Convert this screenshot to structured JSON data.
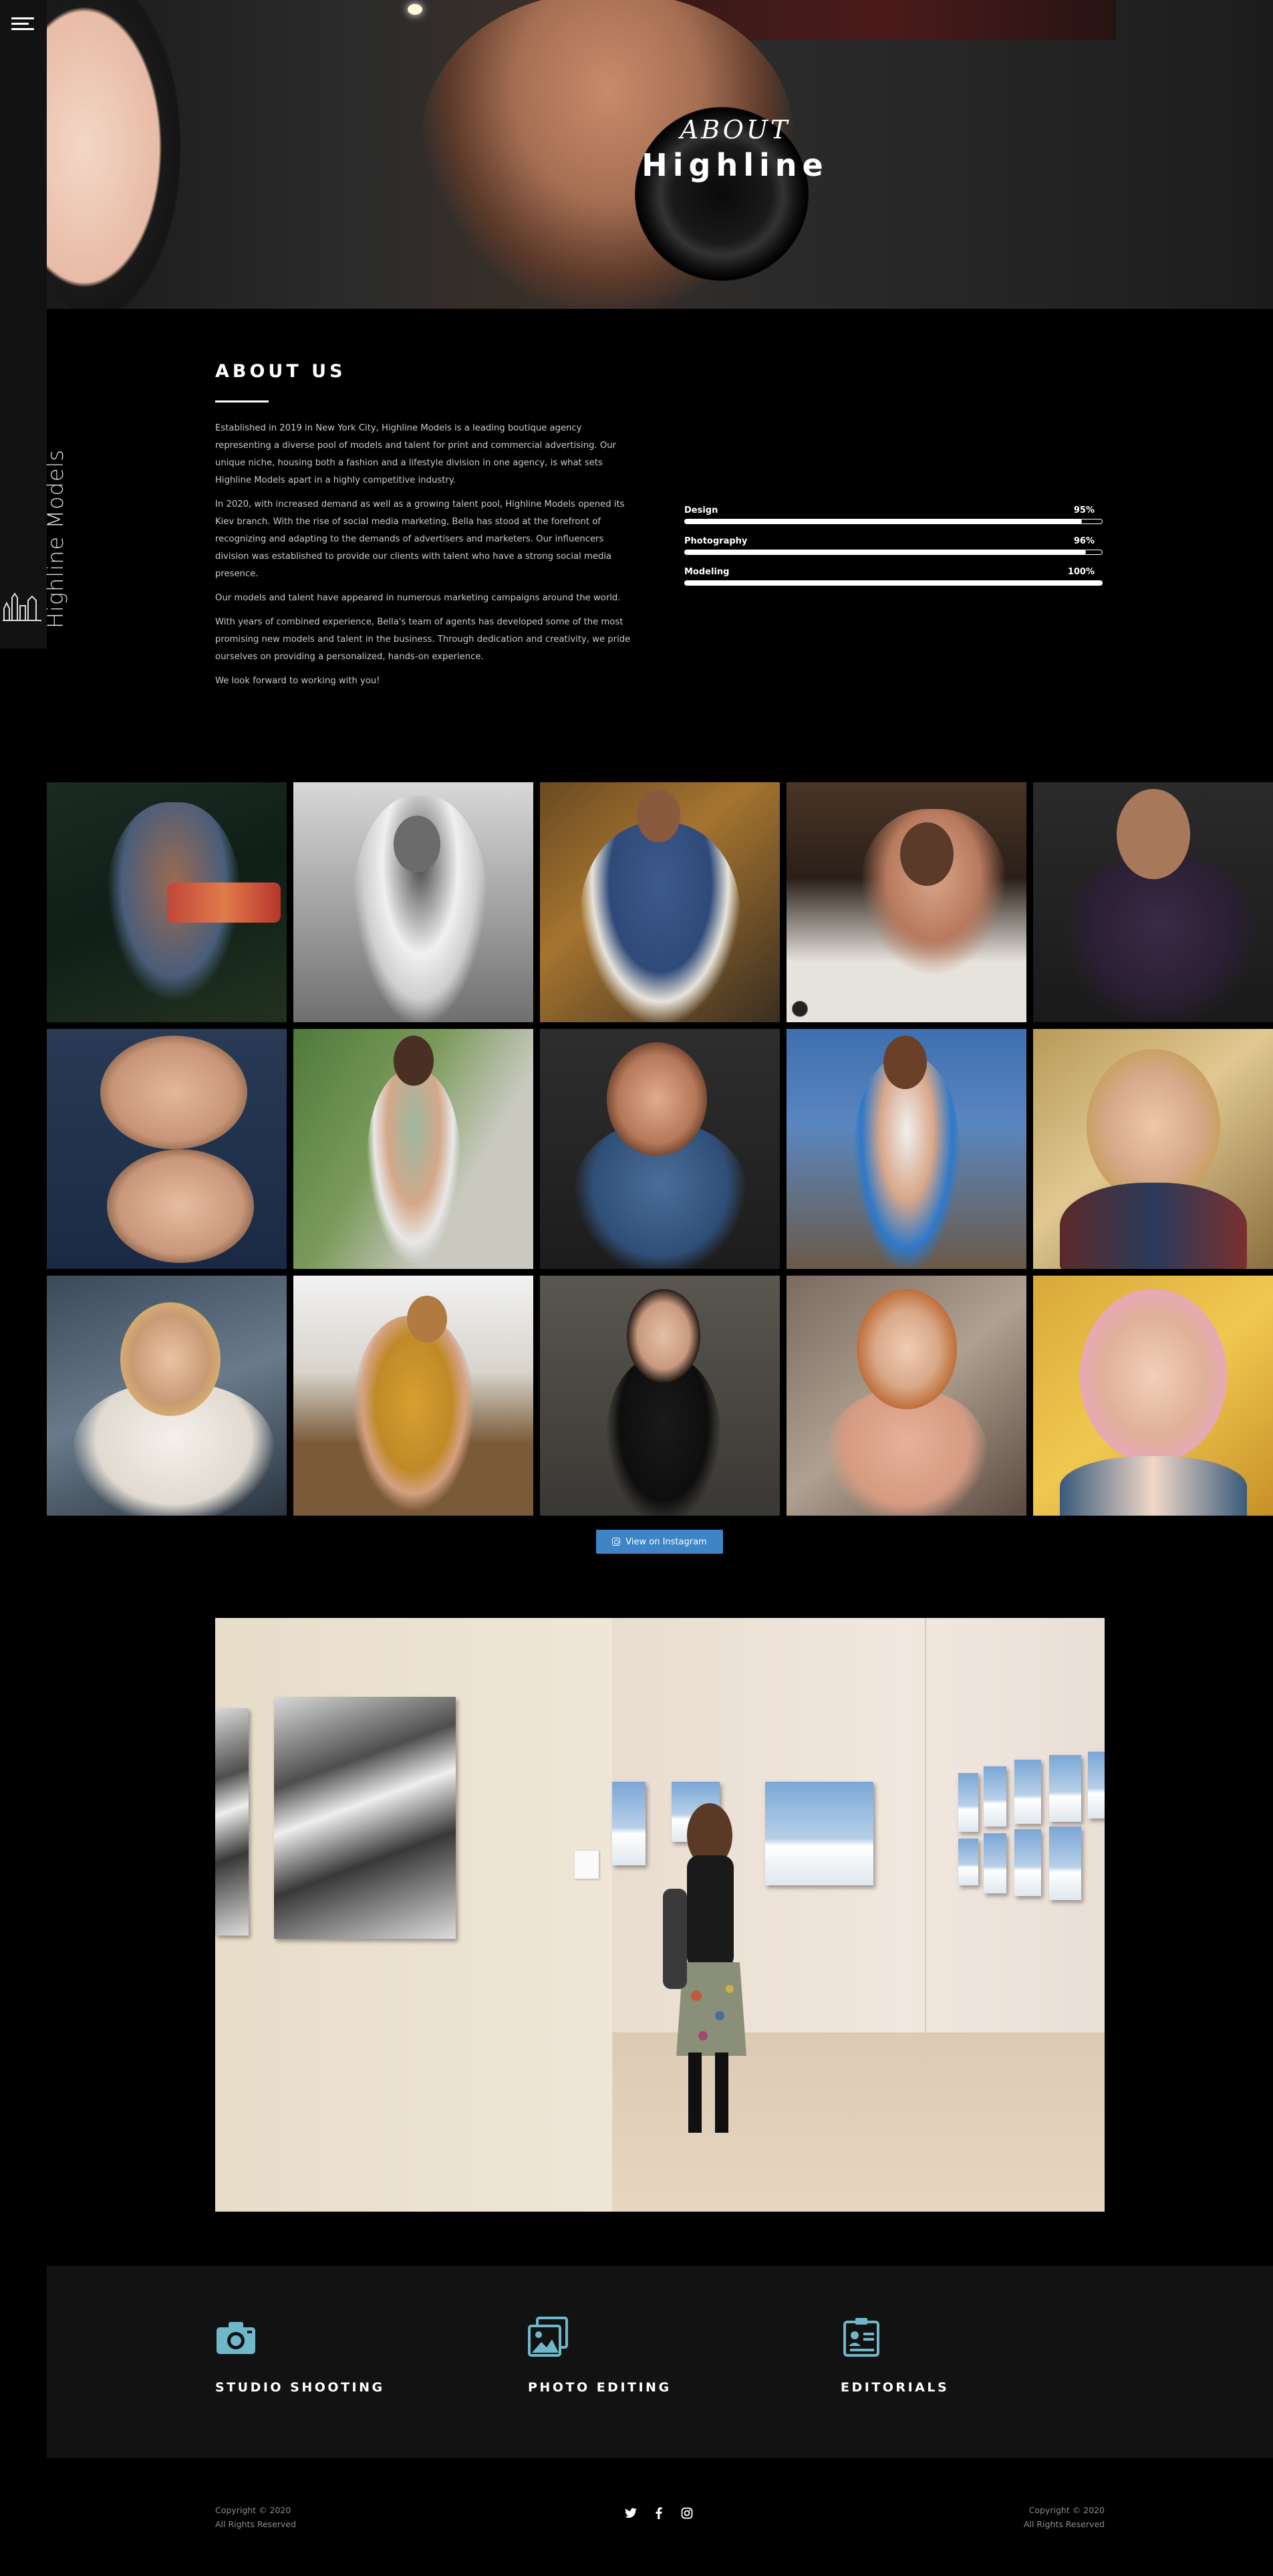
{
  "brand": {
    "logo_text": "Highline Models"
  },
  "hero": {
    "script_text": "ABOUT",
    "title": "Highline"
  },
  "about": {
    "heading": "ABOUT US",
    "paragraphs": [
      "Established in 2019 in New York City, Highline Models is a leading boutique agency representing a diverse pool of models and talent for print and commercial advertising. Our unique niche, housing both a fashion and a lifestyle division in one agency, is what sets Highline Models apart in a highly competitive industry.",
      "In 2020, with increased demand as well as a growing talent pool, Highline Models opened its Kiev branch. With the rise of social media marketing, Bella has stood at the forefront of recognizing and adapting to the demands of advertisers and marketers. Our influencers division was established to provide our clients with talent who have a strong social media presence.",
      "Our models and talent have appeared in numerous marketing campaigns around the world.",
      "With years of combined experience, Bella's team of agents has developed some of the most promising new models and talent in the business. Through dedication and creativity, we pride ourselves on providing a personalized, hands-on experience.",
      "We look forward to working with you!"
    ]
  },
  "skills": [
    {
      "name": "Design",
      "percent_label": "95%",
      "value": 95
    },
    {
      "name": "Photography",
      "percent_label": "96%",
      "value": 96
    },
    {
      "name": "Modeling",
      "percent_label": "100%",
      "value": 100
    }
  ],
  "instagram": {
    "button_label": "View on Instagram"
  },
  "services": [
    {
      "name": "STUDIO SHOOTING",
      "icon": "camera-icon"
    },
    {
      "name": "PHOTO EDITING",
      "icon": "photo-edit-icon"
    },
    {
      "name": "EDITORIALS",
      "icon": "id-badge-icon"
    }
  ],
  "footer": {
    "left_line1": "Copyright © 2020",
    "left_line2": "All Rights Reserved",
    "right_line1": "Copyright © 2020",
    "right_line2": "All Rights Reserved",
    "social_icons": [
      "twitter-icon",
      "facebook-icon",
      "instagram-icon"
    ]
  },
  "colors": {
    "accent_blue": "#3d85c6",
    "icon_teal": "#6fb8c9",
    "panel": "#121212",
    "background": "#000000"
  }
}
